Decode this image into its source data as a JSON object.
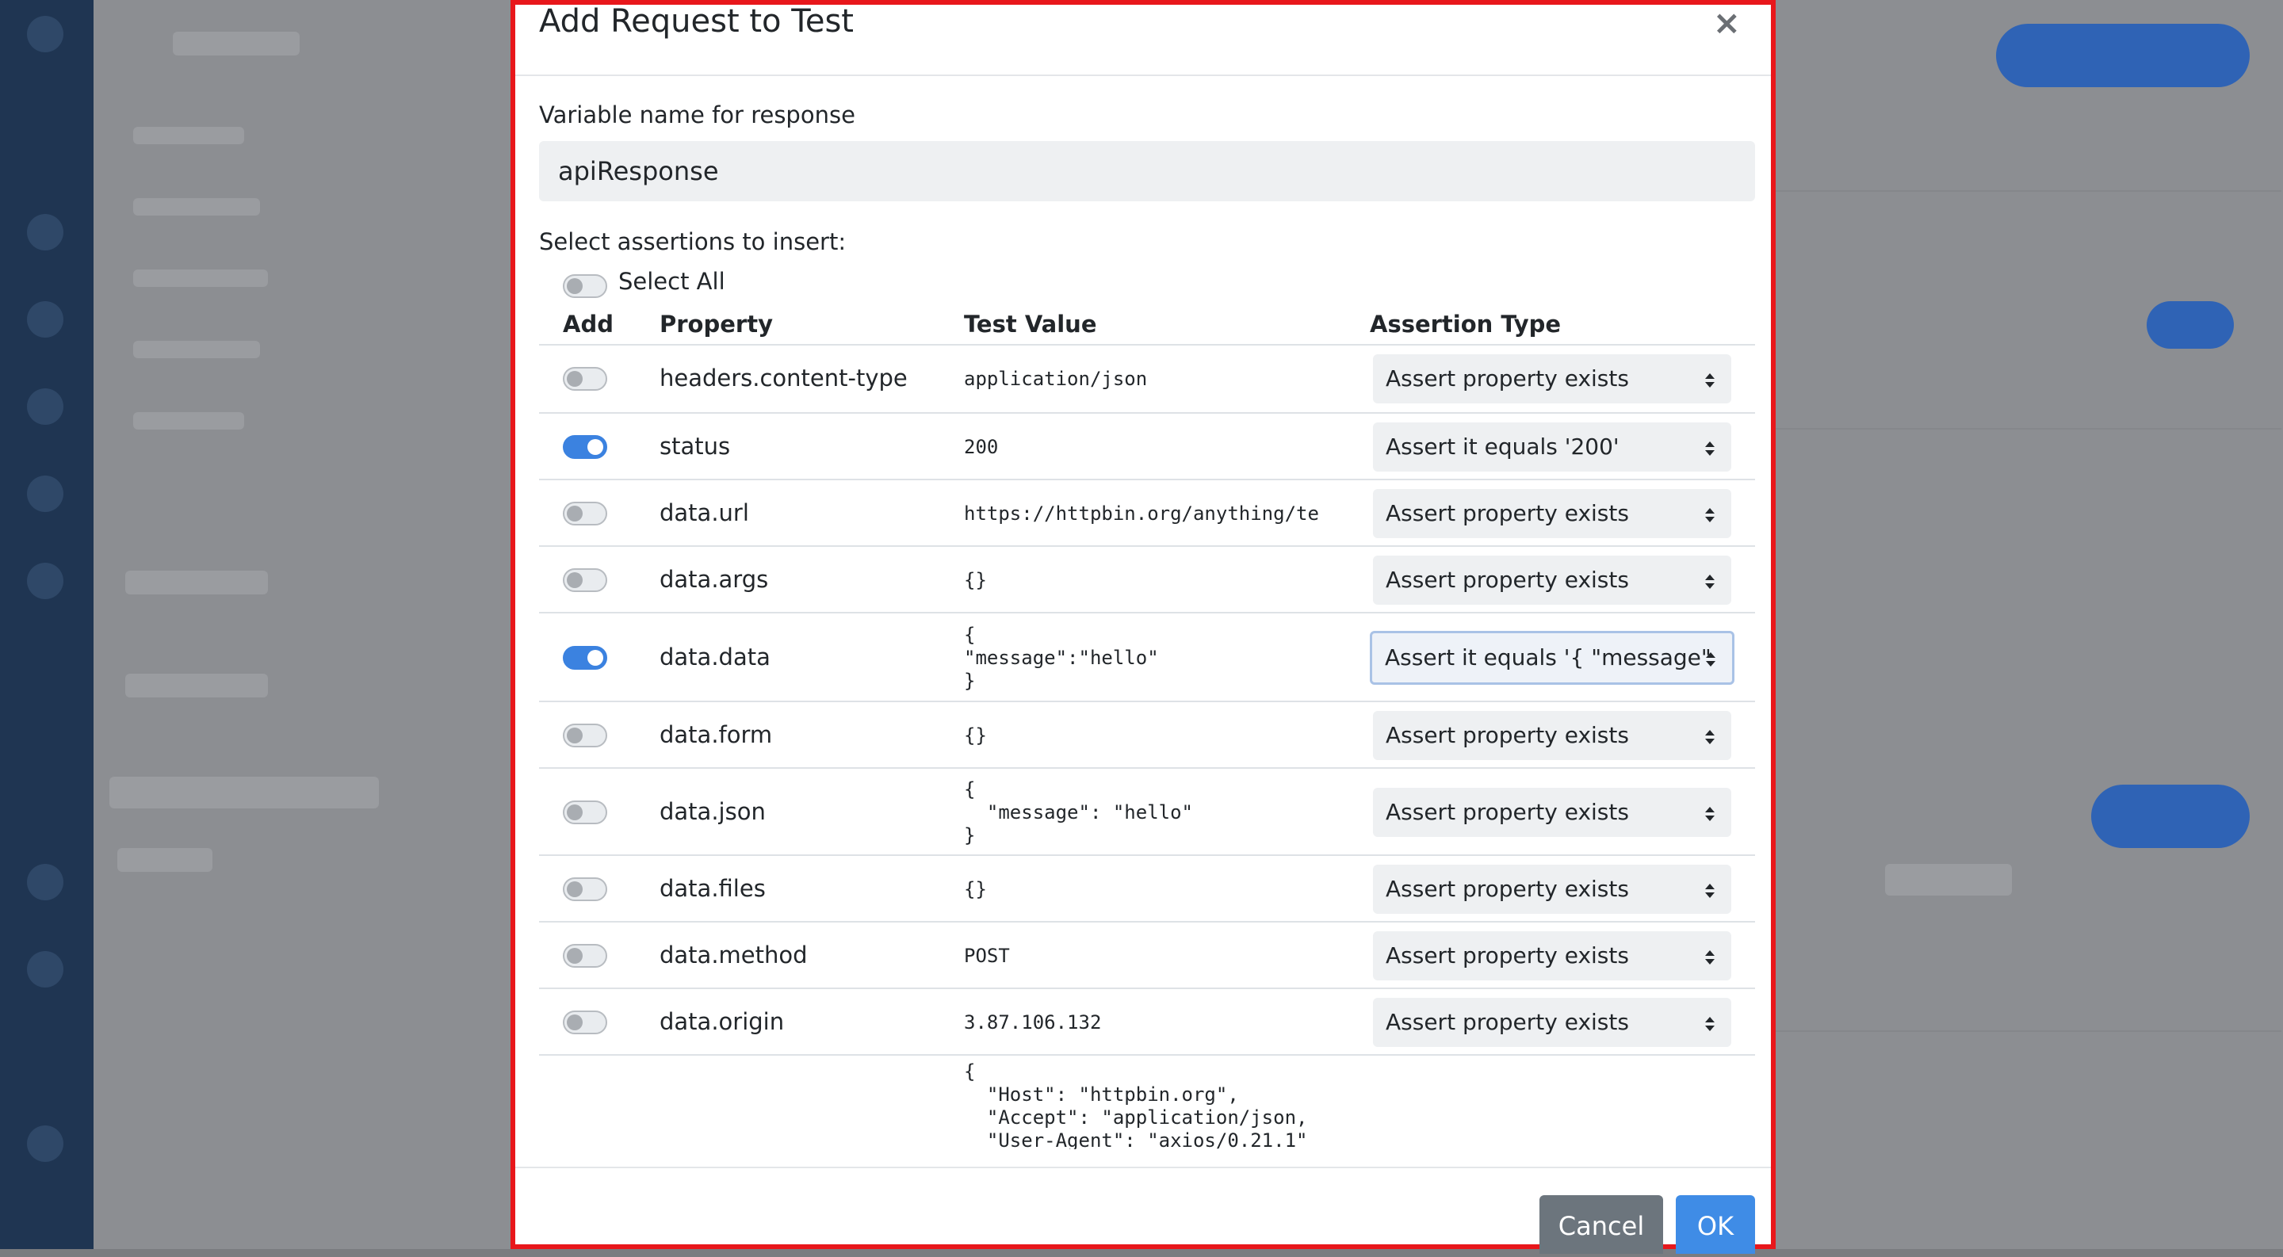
{
  "modal": {
    "title": "Add Request to Test",
    "close_label": "×",
    "variable_label": "Variable name for response",
    "variable_value": "apiResponse",
    "assertions_label": "Select assertions to insert:",
    "select_all_label": "Select All",
    "select_all_on": false,
    "columns": [
      "Add",
      "Property",
      "Test Value",
      "Assertion Type"
    ],
    "rows": [
      {
        "property": "headers.content-type",
        "value": "application/json",
        "assertion": "Assert property exists",
        "enabled": false
      },
      {
        "property": "status",
        "value": "200",
        "assertion": "Assert it equals '200'",
        "enabled": true
      },
      {
        "property": "data.url",
        "value": "https://httpbin.org/anything/te",
        "assertion": "Assert property exists",
        "enabled": false
      },
      {
        "property": "data.args",
        "value": "{}",
        "assertion": "Assert property exists",
        "enabled": false
      },
      {
        "property": "data.data",
        "value": "{\n\"message\":\"hello\"\n}",
        "assertion": "Assert it equals '{ \"message\"",
        "enabled": true,
        "focused": true
      },
      {
        "property": "data.form",
        "value": "{}",
        "assertion": "Assert property exists",
        "enabled": false
      },
      {
        "property": "data.json",
        "value": "{\n  \"message\": \"hello\"\n}",
        "assertion": "Assert property exists",
        "enabled": false
      },
      {
        "property": "data.files",
        "value": "{}",
        "assertion": "Assert property exists",
        "enabled": false
      },
      {
        "property": "data.method",
        "value": "POST",
        "assertion": "Assert property exists",
        "enabled": false
      },
      {
        "property": "data.origin",
        "value": "3.87.106.132",
        "assertion": "Assert property exists",
        "enabled": false
      },
      {
        "property": "",
        "value": "{\n  \"Host\": \"httpbin.org\",\n  \"Accept\": \"application/json,\n  \"User-Agent\": \"axios/0.21.1\"",
        "assertion": "",
        "enabled": null
      }
    ],
    "cancel_label": "Cancel",
    "ok_label": "OK"
  },
  "colors": {
    "highlight_border": "#e8171b",
    "toggle_on": "#3b82e0",
    "ok_button": "#3f8ce6",
    "cancel_button": "#6c757d"
  },
  "icons": {
    "close": "close-icon",
    "select_caret": "sort-caret-icon"
  }
}
